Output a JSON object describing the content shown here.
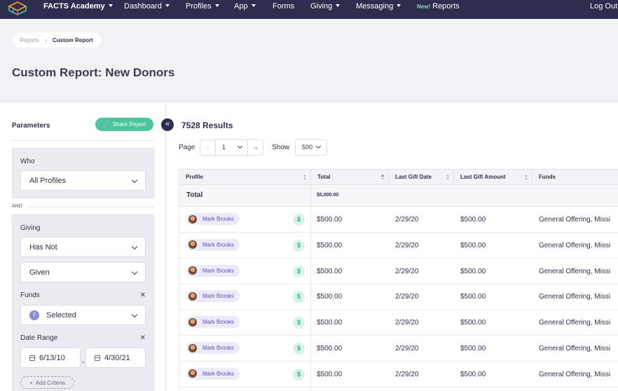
{
  "nav": {
    "brand": "FACTS Academy",
    "items": [
      {
        "label": "Dashboard",
        "caret": true
      },
      {
        "label": "Profiles",
        "caret": true
      },
      {
        "label": "App",
        "caret": true
      },
      {
        "label": "Forms",
        "caret": false
      },
      {
        "label": "Giving",
        "caret": true
      },
      {
        "label": "Messaging",
        "caret": true
      }
    ],
    "new_badge": "New!",
    "reports": "Reports",
    "logout": "Log Out"
  },
  "breadcrumb": {
    "first": "Reports",
    "current": "Custom Report"
  },
  "page_title": "Custom Report: New Donors",
  "params": {
    "title": "Parameters",
    "share_label": "Share Report",
    "who_label": "Who",
    "who_value": "All Profiles",
    "and_label": "AND",
    "giving_label": "Giving",
    "giving_cond": "Has Not",
    "giving_action": "Given",
    "funds_label": "Funds",
    "funds_count": "2",
    "funds_value": "Selected",
    "date_label": "Date Range",
    "date_start": "6/13/10",
    "date_end": "4/30/21",
    "add_criteria": "Add Criteria"
  },
  "results": {
    "title": "7528 Results",
    "page_label": "Page",
    "page_value": "1",
    "show_label": "Show",
    "show_value": "500"
  },
  "table": {
    "headers": [
      "Profile",
      "Total",
      "Last Gift Date",
      "Last Gift Amount",
      "Funds"
    ],
    "total_label": "Total",
    "total_value": "$5,000.00",
    "rows": [
      {
        "name": "Mark Brooks",
        "total": "$500.00",
        "date": "2/29/20",
        "amount": "$500.00",
        "funds": "General Offering, Missi"
      },
      {
        "name": "Mark Brooks",
        "total": "$500.00",
        "date": "2/29/20",
        "amount": "$500.00",
        "funds": "General Offering, Missi"
      },
      {
        "name": "Mark Brooks",
        "total": "$500.00",
        "date": "2/29/20",
        "amount": "$500.00",
        "funds": "General Offering, Missi"
      },
      {
        "name": "Mark Brooks",
        "total": "$500.00",
        "date": "2/29/20",
        "amount": "$500.00",
        "funds": "General Offering, Missi"
      },
      {
        "name": "Mark Brooks",
        "total": "$500.00",
        "date": "2/29/20",
        "amount": "$500.00",
        "funds": "General Offering, Missi"
      },
      {
        "name": "Mark Brooks",
        "total": "$500.00",
        "date": "2/29/20",
        "amount": "$500.00",
        "funds": "General Offering, Missi"
      },
      {
        "name": "Mark Brooks",
        "total": "$500.00",
        "date": "2/29/20",
        "amount": "$500.00",
        "funds": "General Offering, Missi"
      }
    ]
  },
  "colors": {
    "nav_bg": "#2e2d4f",
    "accent_green": "#4cc59a",
    "chip_text": "#5a52c2"
  }
}
